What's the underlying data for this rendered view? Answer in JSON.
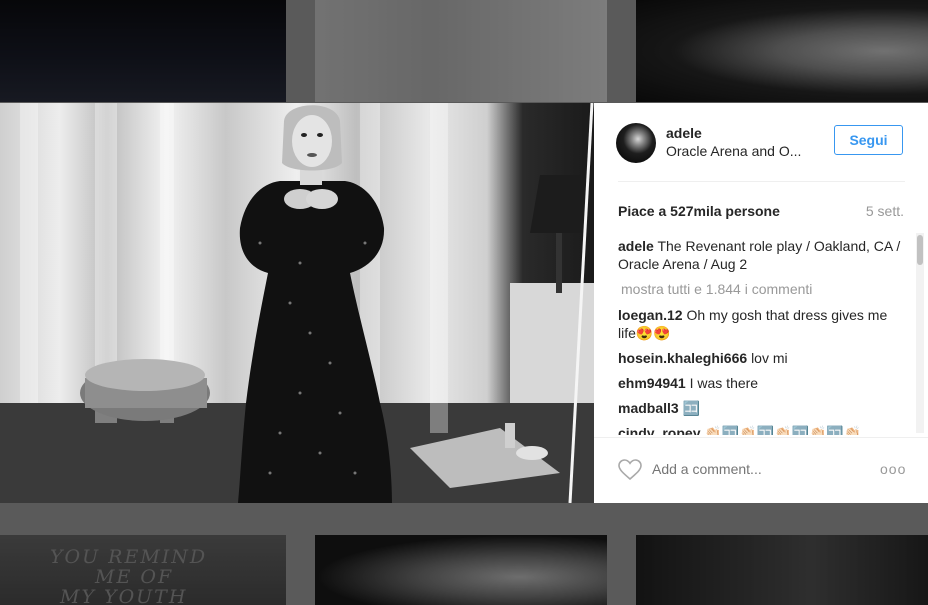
{
  "post": {
    "username": "adele",
    "location": "Oracle Arena and O...",
    "follow_label": "Segui",
    "likes": "Piace a 527mila persone",
    "date": "5 sett.",
    "caption_user": "adele",
    "caption_text": "The Revenant role play / Oakland, CA / Oracle Arena / Aug 2",
    "show_all": "mostra tutti e 1.844 i commenti",
    "comments": [
      {
        "user": "loegan.12",
        "text": "Oh my gosh that dress gives me life😍😍"
      },
      {
        "user": "hosein.khaleghi666",
        "text": "lov mi"
      },
      {
        "user": "ehm94941",
        "text": "I was there"
      },
      {
        "user": "madball3",
        "text": "🈁"
      },
      {
        "user": "cindy_ropey",
        "text": "👏🏻🈁👏🏻🈁👏🏻🈁👏🏻🈁👏🏻"
      }
    ],
    "add_comment_placeholder": "Add a comment...",
    "more_label": "ooo"
  },
  "background": {
    "chalk_text": "YOU REMIND ME OF MY YOUTH"
  },
  "icons": {
    "heart": "heart-icon",
    "more": "more-options-icon",
    "avatar": "avatar"
  },
  "colors": {
    "accent": "#3897f0",
    "text": "#262626",
    "muted": "#999999"
  }
}
